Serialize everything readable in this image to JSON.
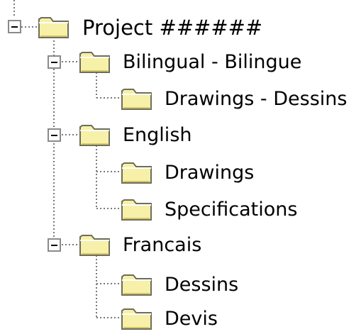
{
  "tree": {
    "root": {
      "label": "Project ######",
      "icon": "folder-icon",
      "expanded": true,
      "children": [
        {
          "label": "Bilingual - Bilingue",
          "icon": "folder-icon",
          "expanded": true,
          "children": [
            {
              "label": "Drawings - Dessins",
              "icon": "folder-icon"
            }
          ]
        },
        {
          "label": "English",
          "icon": "folder-icon",
          "expanded": true,
          "children": [
            {
              "label": "Drawings",
              "icon": "folder-icon"
            },
            {
              "label": "Specifications",
              "icon": "folder-icon"
            }
          ]
        },
        {
          "label": "Francais",
          "icon": "folder-icon",
          "expanded": true,
          "children": [
            {
              "label": "Dessins",
              "icon": "folder-icon"
            },
            {
              "label": "Devis",
              "icon": "folder-icon"
            }
          ]
        }
      ]
    },
    "colors": {
      "folder_fill": "#f7f0a8",
      "folder_outline": "#6d6d5a",
      "guide_line": "#7a7a7a",
      "expander_border": "#8a8a8a"
    }
  }
}
